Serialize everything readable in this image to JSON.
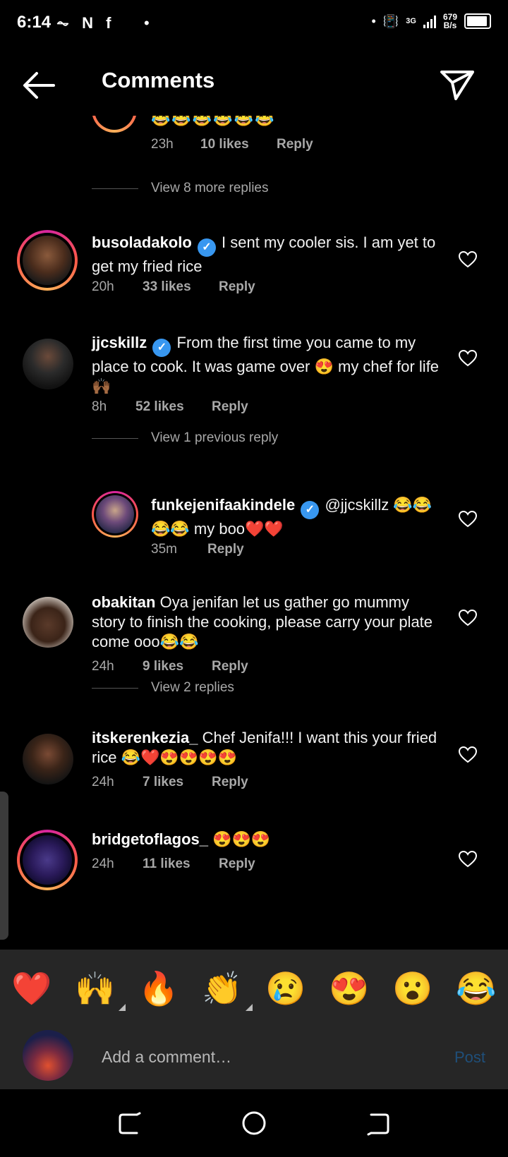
{
  "status_bar": {
    "time": "6:14",
    "left_icons": "⏦ N f",
    "net_speed_value": "679",
    "net_speed_unit": "B/s",
    "network": "3G"
  },
  "header": {
    "title": "Comments",
    "back_icon": "arrow-left-icon",
    "share_icon": "paper-plane-icon"
  },
  "top_partial": {
    "emoji": "😂😂😂😂😂😂",
    "time": "23h",
    "likes": "10 likes",
    "reply": "Reply"
  },
  "view_more_replies": "View 8 more replies",
  "comments": [
    {
      "user": "busoladakolo",
      "verified": true,
      "text": "I sent my cooler sis. I am yet to get my fried rice",
      "time": "20h",
      "likes": "33 likes",
      "reply": "Reply"
    },
    {
      "user": "jjcskillz",
      "verified": true,
      "text": "From the first time you came to my place to cook. It was game over 😍 my chef for life 🙌🏾",
      "time": "8h",
      "likes": "52 likes",
      "reply": "Reply"
    },
    {
      "user": "funkejenifaakindele",
      "verified": true,
      "text": "@jjcskillz 😂😂😂😂 my boo❤️❤️",
      "time": "35m",
      "likes": "",
      "reply": "Reply"
    },
    {
      "user": "obakitan",
      "verified": false,
      "text": "Oya jenifan let us gather go mummy story to finish the cooking, please carry your plate come ooo😂😂",
      "time": "24h",
      "likes": "9 likes",
      "reply": "Reply"
    },
    {
      "user": "itskerenkezia_",
      "verified": false,
      "text": "Chef Jenifa!!! I want this your fried rice 😂❤️😍😍😍😍",
      "time": "24h",
      "likes": "7 likes",
      "reply": "Reply"
    },
    {
      "user": "bridgetoflagos_",
      "verified": false,
      "text": "😍😍😍",
      "time": "24h",
      "likes": "11 likes",
      "reply": "Reply"
    }
  ],
  "view_previous_reply": "View 1 previous reply",
  "view_2_replies": "View 2 replies",
  "reactions": [
    "❤️",
    "🙌",
    "🔥",
    "👏",
    "😢",
    "😍",
    "😮",
    "😂"
  ],
  "composer": {
    "placeholder": "Add a comment…",
    "post": "Post"
  },
  "colors": {
    "background": "#000000",
    "muted_text": "#a8a8a8",
    "verified_blue": "#3897f0",
    "bar_bg": "#262626",
    "post_disabled": "#1f4f7a"
  }
}
